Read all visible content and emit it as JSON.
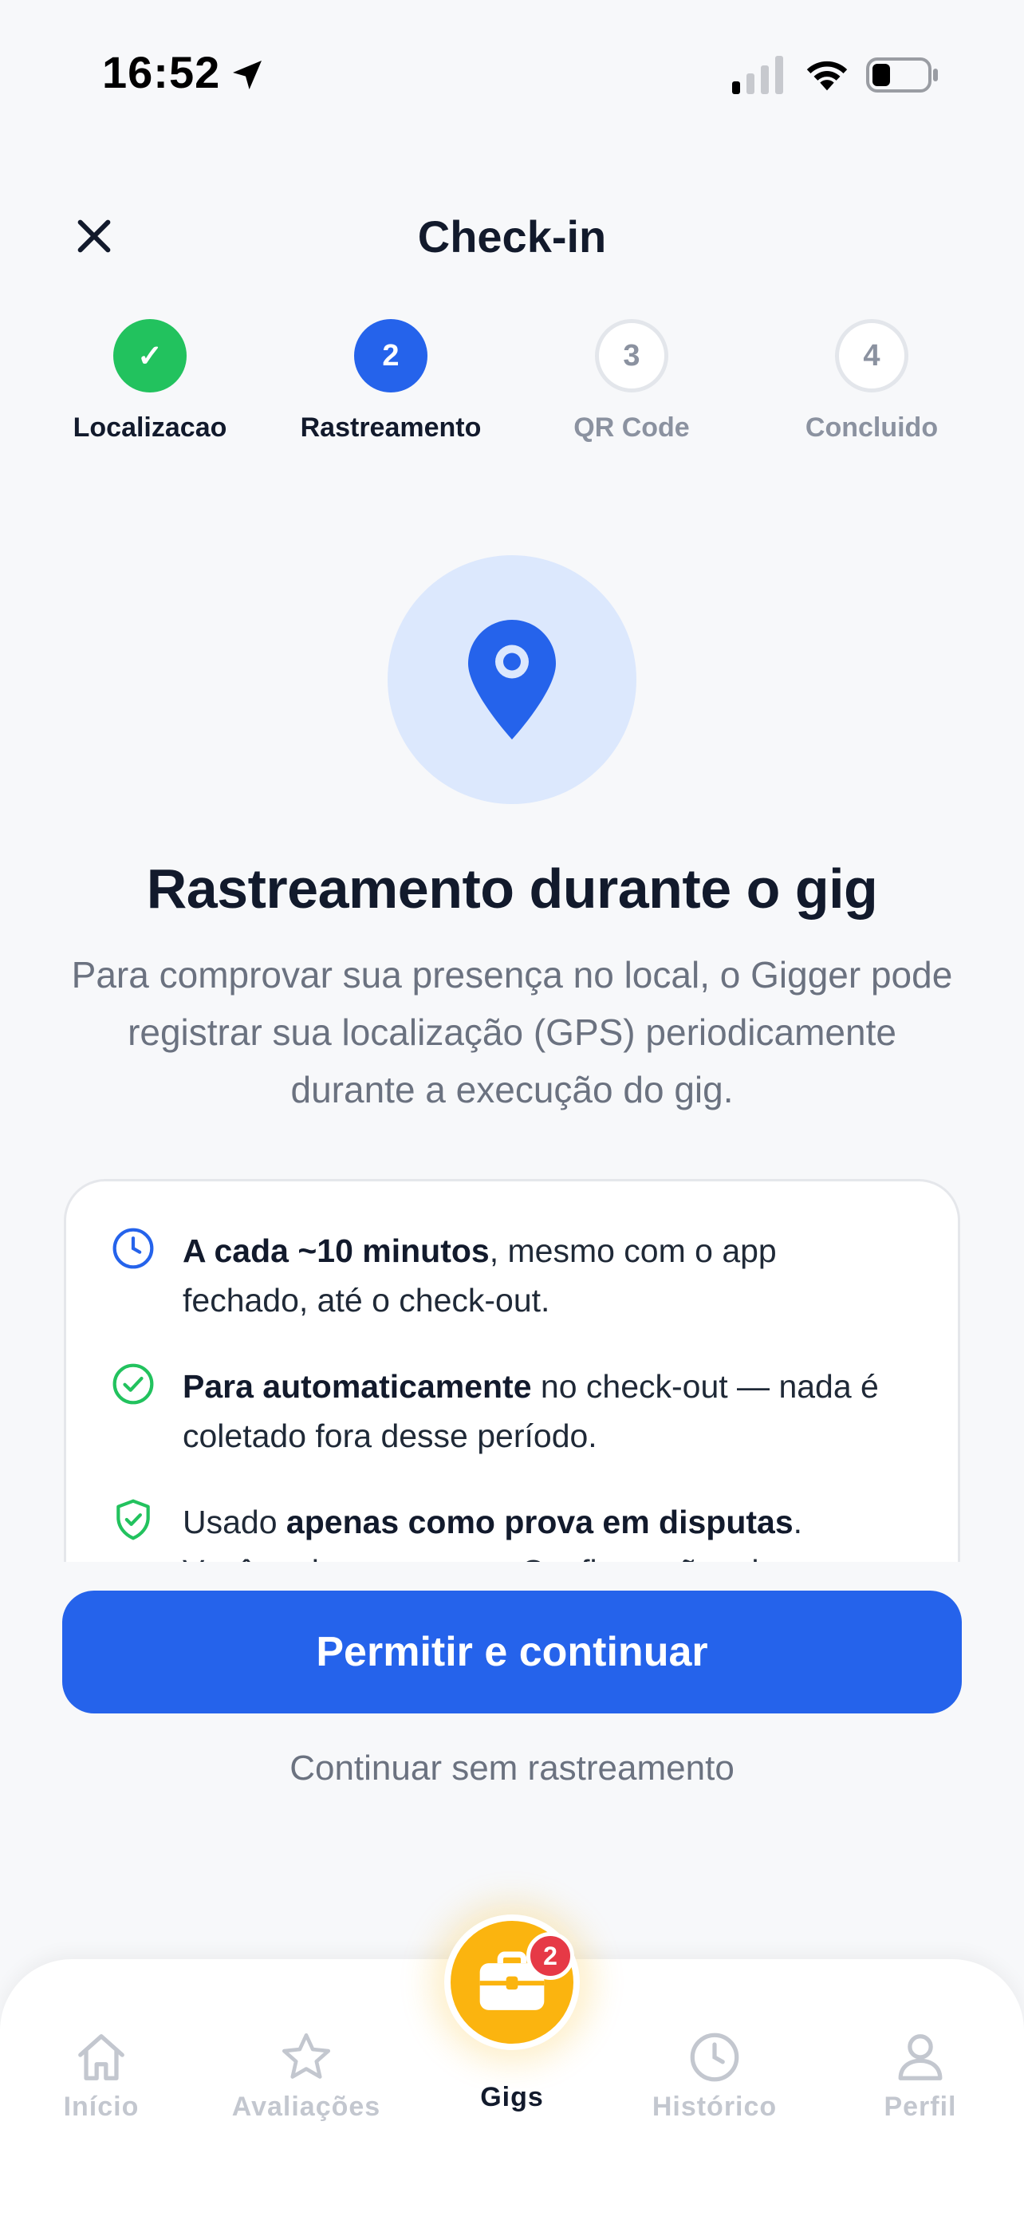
{
  "status_bar": {
    "time": "16:52"
  },
  "header": {
    "title": "Check-in",
    "close_icon": "close-icon"
  },
  "stepper": {
    "steps": [
      {
        "number": "✓",
        "label": "Localizacao",
        "state": "done"
      },
      {
        "number": "2",
        "label": "Rastreamento",
        "state": "active"
      },
      {
        "number": "3",
        "label": "QR Code",
        "state": "pending"
      },
      {
        "number": "4",
        "label": "Concluido",
        "state": "pending"
      }
    ]
  },
  "hero": {
    "icon": "map-pin-icon",
    "title": "Rastreamento durante o gig",
    "description": "Para comprovar sua presença no local, o Gigger pode registrar sua localização (GPS) periodicamente durante a execução do gig."
  },
  "info": {
    "items": [
      {
        "icon": "clock-icon",
        "bold": "A cada ~10 minutos",
        "text": ", mesmo com o app fechado, até o check-out."
      },
      {
        "icon": "check-circle-icon",
        "bold": "Para automaticamente",
        "text": " no check-out — nada é coletado fora desse período."
      },
      {
        "icon": "shield-check-icon",
        "prefix": "Usado ",
        "bold": "apenas como prova em disputas",
        "text": ".",
        "continuation": "Você pode revogar em Configurações do"
      }
    ]
  },
  "actions": {
    "primary": "Permitir e continuar",
    "secondary": "Continuar sem rastreamento"
  },
  "nav": {
    "items": [
      {
        "label": "Início",
        "icon": "home-icon"
      },
      {
        "label": "Avaliações",
        "icon": "star-icon"
      },
      {
        "label": "Gigs",
        "icon": "briefcase-icon",
        "active": true,
        "badge": "2"
      },
      {
        "label": "Histórico",
        "icon": "clock-icon"
      },
      {
        "label": "Perfil",
        "icon": "user-icon"
      }
    ]
  },
  "colors": {
    "primary": "#2563EB",
    "success": "#22C25E",
    "accent": "#FBB40F",
    "badge": "#E63946"
  }
}
